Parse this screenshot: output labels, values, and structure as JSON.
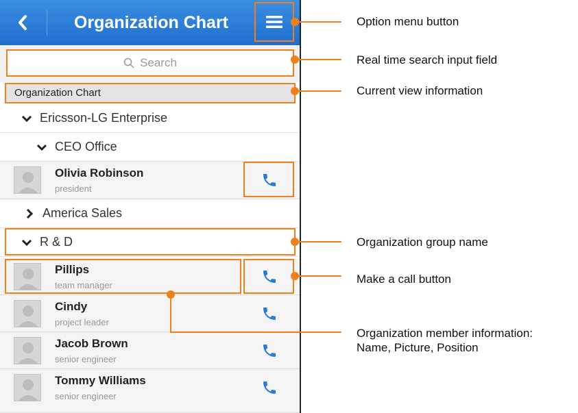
{
  "header": {
    "title": "Organization Chart",
    "back_icon": "chevron-left-icon",
    "menu_icon": "hamburger-menu-icon"
  },
  "search": {
    "placeholder": "Search"
  },
  "breadcrumb": "Organization Chart",
  "groups": {
    "enterprise": "Ericsson-LG Enterprise",
    "ceo_office": "CEO Office",
    "america_sales": "America Sales",
    "rnd": "R & D"
  },
  "members": [
    {
      "name": "Olivia Robinson",
      "position": "president"
    },
    {
      "name": "Pillips",
      "position": "team manager"
    },
    {
      "name": "Cindy",
      "position": "project leader"
    },
    {
      "name": "Jacob Brown",
      "position": "senior engineer"
    },
    {
      "name": "Tommy Williams",
      "position": "senior engineer"
    }
  ],
  "annotations": {
    "option_menu": "Option menu button",
    "search_field": "Real time search input field",
    "current_view": "Current view information",
    "group_name": "Organization group name",
    "call_button": "Make a call button",
    "member_info_1": "Organization member information:",
    "member_info_2": "Name, Picture, Position"
  },
  "colors": {
    "accent": "#f07f1e",
    "header_blue": "#2a7bd8",
    "call_blue": "#2a7bd8"
  }
}
